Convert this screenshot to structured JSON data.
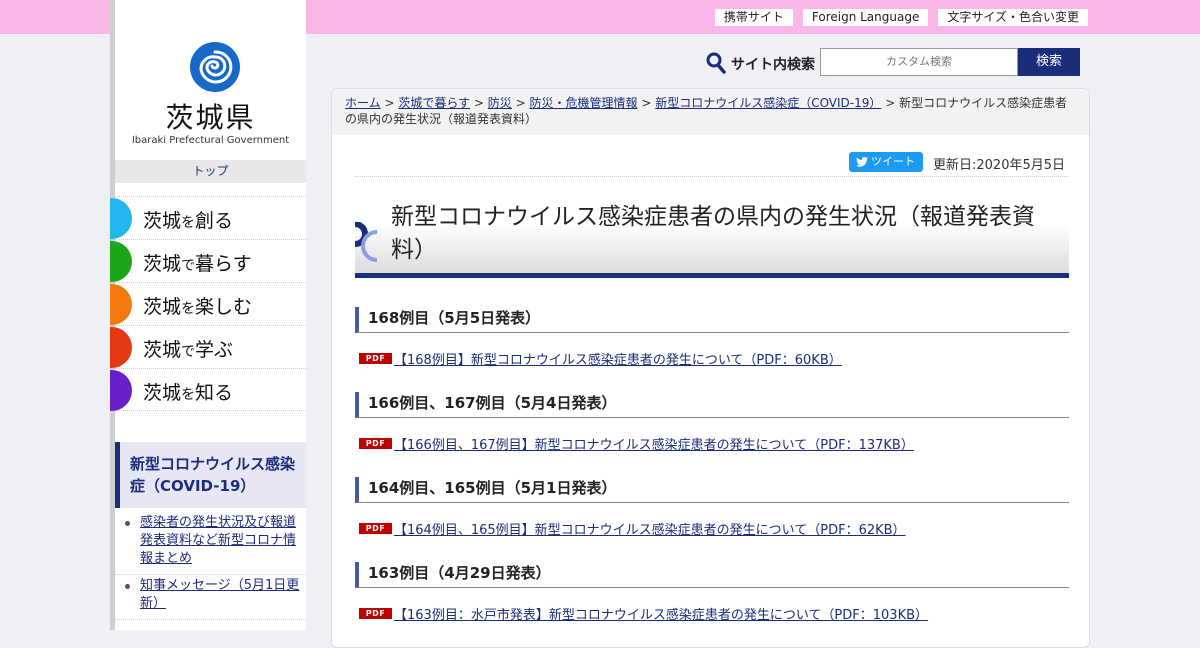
{
  "header": {
    "links": [
      "携帯サイト",
      "Foreign Language",
      "文字サイズ・色合い変更"
    ]
  },
  "logo": {
    "name": "茨城県",
    "subtitle": "Ibaraki Prefectural Government"
  },
  "sidebar": {
    "top_label": "トップ",
    "nav": [
      {
        "pre": "茨城",
        "particle": "を",
        "post": "創る",
        "color": "#21b7ee"
      },
      {
        "pre": "茨城",
        "particle": "で",
        "post": "暮らす",
        "color": "#1aa81a"
      },
      {
        "pre": "茨城",
        "particle": "を",
        "post": "楽しむ",
        "color": "#f47a10"
      },
      {
        "pre": "茨城",
        "particle": "で",
        "post": "学ぶ",
        "color": "#e63812"
      },
      {
        "pre": "茨城",
        "particle": "を",
        "post": "知る",
        "color": "#6a1fc8"
      }
    ],
    "covid_heading": "新型コロナウイルス感染症（COVID-19）",
    "sub_items": [
      "感染者の発生状況及び報道発表資料など新型コロナ情報まとめ",
      "知事メッセージ（5月1日更新）"
    ]
  },
  "search": {
    "label": "サイト内検索",
    "placeholder": "カスタム検索",
    "button": "検索"
  },
  "breadcrumb": {
    "links": [
      "ホーム",
      "茨城で暮らす",
      "防災",
      "防災・危機管理情報",
      "新型コロナウイルス感染症（COVID-19）"
    ],
    "current": "新型コロナウイルス感染症患者の県内の発生状況（報道発表資料）"
  },
  "tweet_label": "ツイート",
  "updated": "更新日:2020年5月5日",
  "page_title": "新型コロナウイルス感染症患者の県内の発生状況（報道発表資料）",
  "pdf_icon_label": "PDF",
  "sections": [
    {
      "heading": "168例目（5月5日発表）",
      "link": "【168例目】新型コロナウイルス感染症患者の発生について（PDF：60KB）"
    },
    {
      "heading": "166例目、167例目（5月4日発表）",
      "link": "【166例目、167例目】新型コロナウイルス感染症患者の発生について（PDF：137KB）"
    },
    {
      "heading": "164例目、165例目（5月1日発表）",
      "link": "【164例目、165例目】新型コロナウイルス感染症患者の発生について（PDF：62KB）"
    },
    {
      "heading": "163例目（4月29日発表）",
      "link": "【163例目：水戸市発表】新型コロナウイルス感染症患者の発生について（PDF：103KB）"
    }
  ],
  "colors": {
    "topbar": "#fbb6e8",
    "accent": "#1a2d7a",
    "pdf": "#c00000",
    "twitter": "#1d9bf0"
  }
}
